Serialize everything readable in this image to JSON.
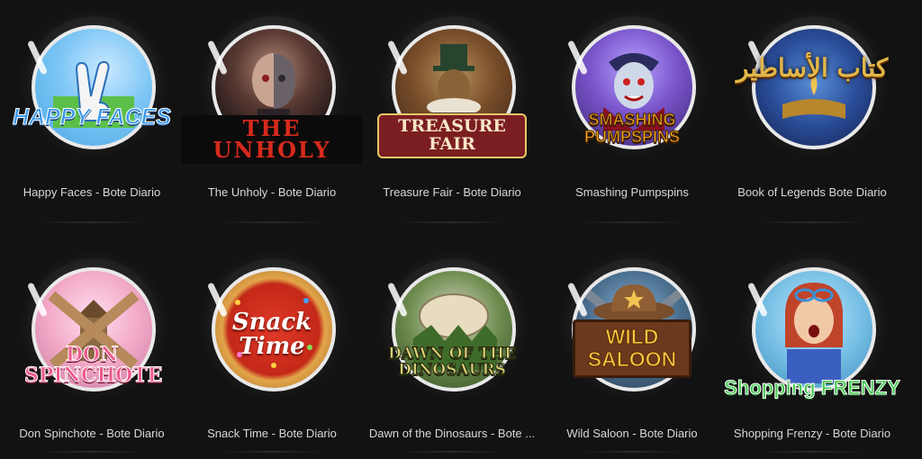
{
  "games": [
    {
      "label": "Happy Faces - Bote Diario",
      "logo": "HAPPY FACES",
      "icon": "peace-hand-icon",
      "logo_color": "#2f8fe3"
    },
    {
      "label": "The Unholy - Bote Diario",
      "logo": "THE UNHOLY",
      "icon": "vampire-face-icon",
      "logo_color": "#d62a1d"
    },
    {
      "label": "Treasure Fair - Bote Diario",
      "logo": "TREASURE FAIR",
      "icon": "showman-icon",
      "logo_color": "#f6e7c6"
    },
    {
      "label": "Smashing Pumpspins",
      "logo": "SMASHING PUMPSPINS",
      "icon": "dracula-icon",
      "logo_color": "#f4a41d"
    },
    {
      "label": "Book of Legends Bote Diario",
      "logo": "كتاب الأساطير",
      "icon": "book-icon",
      "logo_color": "#e2b64a"
    },
    {
      "label": "Don Spinchote - Bote Diario",
      "logo": "DON SPINCHOTE",
      "icon": "windmill-icon",
      "logo_color": "#e63c6e"
    },
    {
      "label": "Snack Time - Bote Diario",
      "logo": "Snack Time",
      "icon": "donut-icon",
      "logo_color": "#ffffff"
    },
    {
      "label": "Dawn of the Dinosaurs - Bote ...",
      "logo": "DAWN OF THE DINOSAURS",
      "icon": "egg-icon",
      "logo_color": "#c9d17a"
    },
    {
      "label": "Wild Saloon - Bote Diario",
      "logo": "WILD SALOON",
      "icon": "sheriff-hat-icon",
      "logo_color": "#f7c744"
    },
    {
      "label": "Shopping Frenzy - Bote Diario",
      "logo": "Shopping FRENZY",
      "icon": "shopper-icon",
      "logo_color": "#3fc64a"
    }
  ]
}
